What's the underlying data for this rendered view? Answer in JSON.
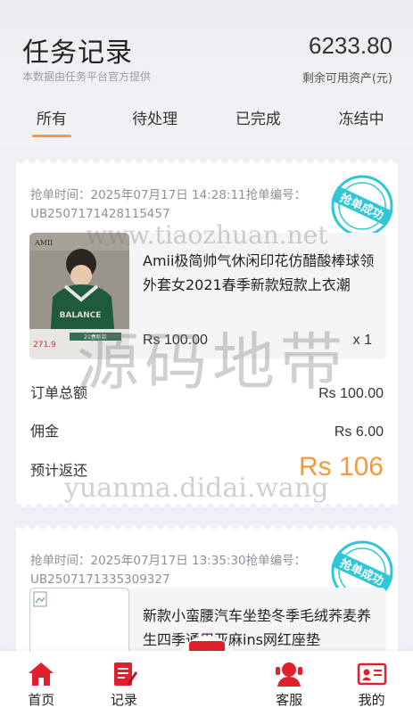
{
  "header": {
    "title": "任务记录",
    "subtitle": "本数据由任务平台官方提供",
    "balance": "6233.80",
    "balance_label": "剩余可用资产(元)"
  },
  "tabs": [
    {
      "label": "所有",
      "active": true
    },
    {
      "label": "待处理",
      "active": false
    },
    {
      "label": "已完成",
      "active": false
    },
    {
      "label": "冻结中",
      "active": false
    }
  ],
  "orders": [
    {
      "meta": "抢单时间：2025年07月17日 14:28:11抢单编号：UB2507171428115457",
      "stamp": "抢单成功",
      "product_name": "Amii极简帅气休闲印花仿醋酸棒球领外套女2021春季新款短款上衣潮",
      "price": "Rs 100.00",
      "qty": "x 1",
      "total_label": "订单总额",
      "total": "Rs 100.00",
      "commission_label": "佣金",
      "commission": "Rs 6.00",
      "return_label": "预计返还",
      "return": "Rs 106",
      "thumb_text": {
        "brand": "AMII",
        "word": "BALANCE",
        "price": "271.9",
        "tag": "21春新款"
      }
    },
    {
      "meta": "抢单时间：2025年07月17日 13:35:30抢单编号：UB2507171335309327",
      "stamp": "抢单成功",
      "product_name": "新款小蛮腰汽车坐垫冬季毛绒荞麦养生四季通用亚麻ins网红座垫"
    }
  ],
  "watermarks": {
    "w1": "www.tiaozhuan.net",
    "w2": "源码地带",
    "w3": "yuanma.didai.wang"
  },
  "nav": [
    {
      "label": "首页",
      "icon": "home-icon"
    },
    {
      "label": "记录",
      "icon": "record-icon"
    },
    {
      "label": "",
      "icon": "grab-icon"
    },
    {
      "label": "客服",
      "icon": "service-icon"
    },
    {
      "label": "我的",
      "icon": "profile-icon"
    }
  ],
  "colors": {
    "accent": "#f39a3a",
    "brand_red": "#e0212d",
    "stamp": "#2fc7d8"
  }
}
